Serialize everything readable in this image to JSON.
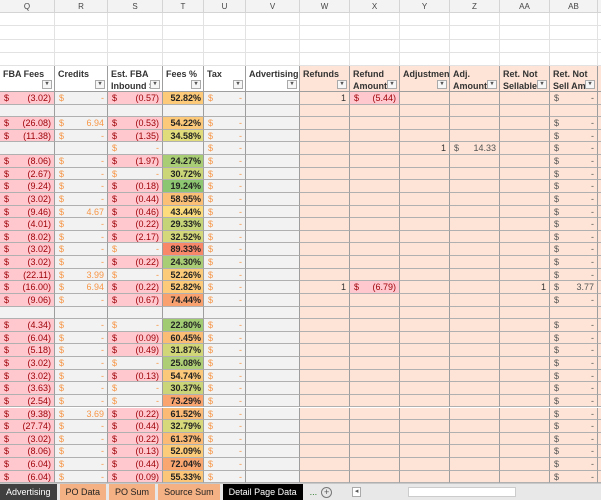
{
  "columns": [
    "Q",
    "R",
    "S",
    "T",
    "U",
    "V",
    "W",
    "X",
    "Y",
    "Z",
    "AA",
    "AB"
  ],
  "headers": [
    [
      "FBA Fees",
      ""
    ],
    [
      "Credits",
      ""
    ],
    [
      "Est. FBA",
      "Inbound Sh"
    ],
    [
      "Fees %",
      ""
    ],
    [
      "Tax",
      ""
    ],
    [
      "Advertising",
      ""
    ],
    [
      "Refunds",
      ""
    ],
    [
      "Refund",
      "Amount"
    ],
    [
      "Adjustment",
      ""
    ],
    [
      "Adj.",
      "Amount"
    ],
    [
      "Ret. Not",
      "Sellable"
    ],
    [
      "Ret. Not",
      "Sell Amt."
    ]
  ],
  "rows": [
    [
      "(3.02)",
      "-",
      "(0.57)",
      "52.82%",
      "-",
      null,
      "1",
      "(5.44)",
      null,
      null,
      null,
      "-"
    ],
    [
      null,
      null,
      null,
      null,
      null,
      null,
      null,
      null,
      null,
      null,
      null,
      null
    ],
    [
      "(26.08)",
      "6.94",
      "(0.53)",
      "54.22%",
      "-",
      null,
      null,
      null,
      null,
      null,
      null,
      "-"
    ],
    [
      "(11.38)",
      "-",
      "(1.35)",
      "34.58%",
      "-",
      null,
      null,
      null,
      null,
      null,
      null,
      "-"
    ],
    [
      null,
      null,
      "-",
      null,
      "-",
      null,
      null,
      null,
      "1",
      "14.33",
      null,
      "-"
    ],
    [
      "(8.06)",
      "-",
      "(1.97)",
      "24.27%",
      "-",
      null,
      null,
      null,
      null,
      null,
      null,
      "-"
    ],
    [
      "(2.67)",
      "-",
      "-",
      "30.72%",
      "-",
      null,
      null,
      null,
      null,
      null,
      null,
      "-"
    ],
    [
      "(9.24)",
      "-",
      "(0.18)",
      "19.24%",
      "-",
      null,
      null,
      null,
      null,
      null,
      null,
      "-"
    ],
    [
      "(3.02)",
      "-",
      "(0.44)",
      "58.95%",
      "-",
      null,
      null,
      null,
      null,
      null,
      null,
      "-"
    ],
    [
      "(9.46)",
      "4.67",
      "(0.46)",
      "43.44%",
      "-",
      null,
      null,
      null,
      null,
      null,
      null,
      "-"
    ],
    [
      "(4.01)",
      "-",
      "(0.22)",
      "29.33%",
      "-",
      null,
      null,
      null,
      null,
      null,
      null,
      "-"
    ],
    [
      "(8.02)",
      "-",
      "(2.17)",
      "32.52%",
      "-",
      null,
      null,
      null,
      null,
      null,
      null,
      "-"
    ],
    [
      "(3.02)",
      "-",
      "-",
      "89.33%",
      "-",
      null,
      null,
      null,
      null,
      null,
      null,
      "-"
    ],
    [
      "(3.02)",
      "-",
      "(0.22)",
      "24.30%",
      "-",
      null,
      null,
      null,
      null,
      null,
      null,
      "-"
    ],
    [
      "(22.11)",
      "3.99",
      "-",
      "52.26%",
      "-",
      null,
      null,
      null,
      null,
      null,
      null,
      "-"
    ],
    [
      "(16.00)",
      "6.94",
      "(0.22)",
      "52.82%",
      "-",
      null,
      "1",
      "(6.79)",
      null,
      null,
      "1",
      "3.77"
    ],
    [
      "(9.06)",
      "-",
      "(0.67)",
      "74.44%",
      "-",
      null,
      null,
      null,
      null,
      null,
      null,
      "-"
    ],
    [
      null,
      null,
      null,
      null,
      null,
      null,
      null,
      null,
      null,
      null,
      null,
      null
    ],
    [
      "(4.34)",
      "-",
      "-",
      "22.80%",
      "-",
      null,
      null,
      null,
      null,
      null,
      null,
      "-"
    ],
    [
      "(6.04)",
      "-",
      "(0.09)",
      "60.45%",
      "-",
      null,
      null,
      null,
      null,
      null,
      null,
      "-"
    ],
    [
      "(5.18)",
      "-",
      "(0.49)",
      "31.87%",
      "-",
      null,
      null,
      null,
      null,
      null,
      null,
      "-"
    ],
    [
      "(3.02)",
      "-",
      "-",
      "25.08%",
      "-",
      null,
      null,
      null,
      null,
      null,
      null,
      "-"
    ],
    [
      "(3.02)",
      "-",
      "(0.13)",
      "54.74%",
      "-",
      null,
      null,
      null,
      null,
      null,
      null,
      "-"
    ],
    [
      "(3.63)",
      "-",
      "-",
      "30.37%",
      "-",
      null,
      null,
      null,
      null,
      null,
      null,
      "-"
    ],
    [
      "(2.54)",
      "-",
      "-",
      "73.29%",
      "-",
      null,
      null,
      null,
      null,
      null,
      null,
      "-"
    ],
    [
      "(9.38)",
      "3.69",
      "(0.22)",
      "61.52%",
      "-",
      null,
      null,
      null,
      null,
      null,
      null,
      "-"
    ],
    [
      "(27.74)",
      "-",
      "(0.44)",
      "32.79%",
      "-",
      null,
      null,
      null,
      null,
      null,
      null,
      "-"
    ],
    [
      "(3.02)",
      "-",
      "(0.22)",
      "61.37%",
      "-",
      null,
      null,
      null,
      null,
      null,
      null,
      "-"
    ],
    [
      "(8.06)",
      "-",
      "(0.13)",
      "52.09%",
      "-",
      null,
      null,
      null,
      null,
      null,
      null,
      "-"
    ],
    [
      "(6.04)",
      "-",
      "(0.44)",
      "72.04%",
      "-",
      null,
      null,
      null,
      null,
      null,
      null,
      "-"
    ],
    [
      "(6.04)",
      "-",
      "(0.09)",
      "55.33%",
      "-",
      null,
      null,
      null,
      null,
      null,
      null,
      "-"
    ]
  ],
  "currency_symbol": "$",
  "filter_icon": "▾",
  "tabs": [
    "Advertising",
    "PO Data",
    "PO Sum",
    "Source Sum",
    "Detail Page Data"
  ],
  "active_tab": "Detail Page Data",
  "more_tabs": "...",
  "add_sheet": "+",
  "scroll_left": "◂",
  "colors": {
    "bad_fill": "#ffc7ce",
    "bad_text": "#9c0006",
    "credit_text": "#f79646",
    "peach": "#fde4d6"
  }
}
